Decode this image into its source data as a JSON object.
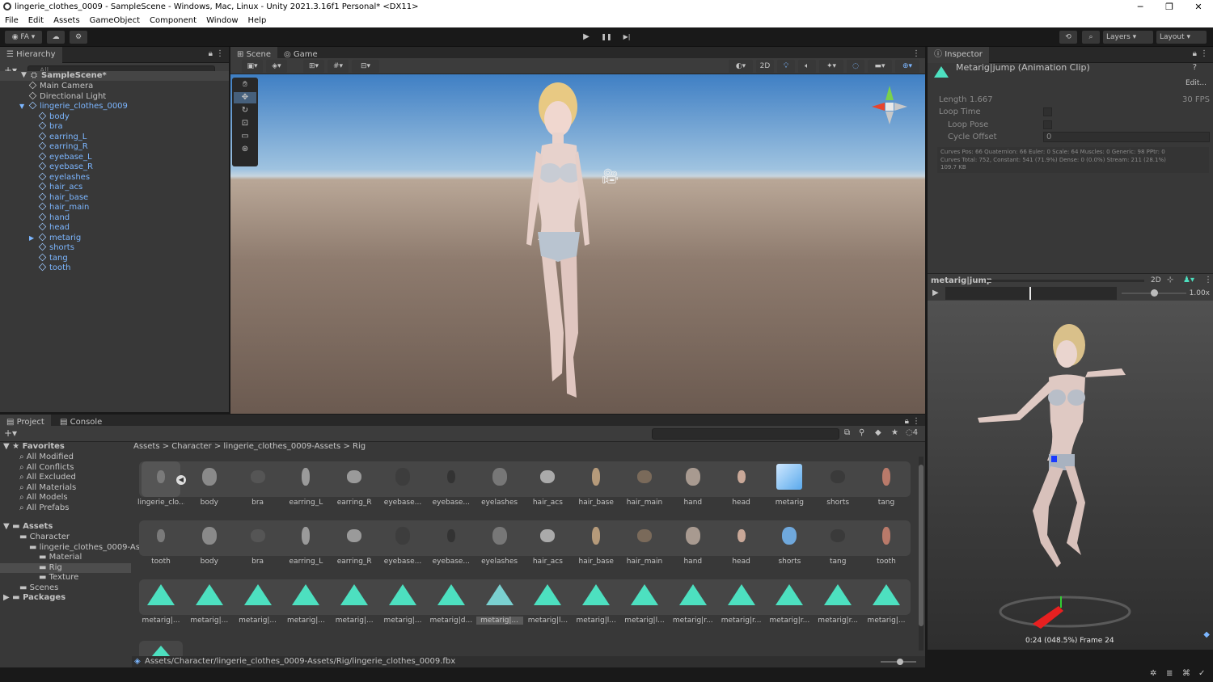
{
  "window": {
    "title": "lingerie_clothes_0009 - SampleScene - Windows, Mac, Linux - Unity 2021.3.16f1 Personal* <DX11>",
    "min": "─",
    "max": "❐",
    "close": "✕"
  },
  "menu": [
    "File",
    "Edit",
    "Assets",
    "GameObject",
    "Component",
    "Window",
    "Help"
  ],
  "toolbar": {
    "account": "FA",
    "layers": "Layers",
    "layout": "Layout",
    "play": "▶",
    "pause": "❚❚",
    "step": "▶|"
  },
  "hierarchy": {
    "tab": "Hierarchy",
    "search_placeholder": "All",
    "scene": "SampleScene*",
    "items": [
      {
        "label": "Main Camera",
        "indent": 1,
        "prefab": false
      },
      {
        "label": "Directional Light",
        "indent": 1,
        "prefab": false
      },
      {
        "label": "lingerie_clothes_0009",
        "indent": 1,
        "prefab": true,
        "expanded": true
      },
      {
        "label": "body",
        "indent": 2,
        "prefab": true
      },
      {
        "label": "bra",
        "indent": 2,
        "prefab": true
      },
      {
        "label": "earring_L",
        "indent": 2,
        "prefab": true
      },
      {
        "label": "earring_R",
        "indent": 2,
        "prefab": true
      },
      {
        "label": "eyebase_L",
        "indent": 2,
        "prefab": true
      },
      {
        "label": "eyebase_R",
        "indent": 2,
        "prefab": true
      },
      {
        "label": "eyelashes",
        "indent": 2,
        "prefab": true
      },
      {
        "label": "hair_acs",
        "indent": 2,
        "prefab": true
      },
      {
        "label": "hair_base",
        "indent": 2,
        "prefab": true
      },
      {
        "label": "hair_main",
        "indent": 2,
        "prefab": true
      },
      {
        "label": "hand",
        "indent": 2,
        "prefab": true
      },
      {
        "label": "head",
        "indent": 2,
        "prefab": true
      },
      {
        "label": "metarig",
        "indent": 2,
        "prefab": true,
        "collapsed": true
      },
      {
        "label": "shorts",
        "indent": 2,
        "prefab": true
      },
      {
        "label": "tang",
        "indent": 2,
        "prefab": true
      },
      {
        "label": "tooth",
        "indent": 2,
        "prefab": true
      }
    ]
  },
  "scene_tabs": {
    "scene": "Scene",
    "game": "Game",
    "mode2d": "2D"
  },
  "project": {
    "tab_project": "Project",
    "tab_console": "Console",
    "hidden_count": "4",
    "favorites_title": "Favorites",
    "favorites": [
      "All Modified",
      "All Conflicts",
      "All Excluded",
      "All Materials",
      "All Models",
      "All Prefabs"
    ],
    "assets_title": "Assets",
    "tree": [
      {
        "label": "Character",
        "indent": 1
      },
      {
        "label": "lingerie_clothes_0009-As",
        "indent": 2
      },
      {
        "label": "Material",
        "indent": 3
      },
      {
        "label": "Rig",
        "indent": 3,
        "selected": true
      },
      {
        "label": "Texture",
        "indent": 3
      },
      {
        "label": "Scenes",
        "indent": 1
      }
    ],
    "packages": "Packages",
    "breadcrumb": [
      "Assets",
      "Character",
      "lingerie_clothes_0009-Assets",
      "Rig"
    ],
    "row1": [
      "lingerie_clo...",
      "body",
      "bra",
      "earring_L",
      "earring_R",
      "eyebase...",
      "eyebase...",
      "eyelashes",
      "hair_acs",
      "hair_base",
      "hair_main",
      "hand",
      "head",
      "metarig",
      "shorts",
      "tang"
    ],
    "row2": [
      "tooth",
      "body",
      "bra",
      "earring_L",
      "earring_R",
      "eyebase...",
      "eyebase...",
      "eyelashes",
      "hair_acs",
      "hair_base",
      "hair_main",
      "hand",
      "head",
      "shorts",
      "tang",
      "tooth"
    ],
    "row3": [
      "metarig|...",
      "metarig|...",
      "metarig|...",
      "metarig|...",
      "metarig|...",
      "metarig|...",
      "metarig|d...",
      "metarig|...",
      "metarig|l...",
      "metarig|l...",
      "metarig|l...",
      "metarig|r...",
      "metarig|r...",
      "metarig|r...",
      "metarig|r...",
      "metarig|..."
    ],
    "status_path": "Assets/Character/lingerie_clothes_0009-Assets/Rig/lingerie_clothes_0009.fbx"
  },
  "inspector": {
    "tab": "Inspector",
    "title": "Metarig|jump (Animation Clip)",
    "edit": "Edit...",
    "length_label": "Length",
    "length": "1.667",
    "fps": "30 FPS",
    "loop_time": "Loop Time",
    "loop_pose": "Loop Pose",
    "cycle_offset": "Cycle Offset",
    "cycle_offset_value": "0",
    "info": [
      "Curves Pos: 66 Quaternion: 66 Euler: 0 Scale: 64 Muscles: 0 Generic: 98 PPtr: 0",
      "Curves Total: 752, Constant: 541 (71.9%) Dense: 0 (0.0%) Stream: 211 (28.1%)",
      "109.7 KB"
    ],
    "preview_title": "metarig|jump",
    "preview_2d": "2D",
    "speed": "1.00x",
    "frame_info": "0:24 (048.5%) Frame 24"
  }
}
